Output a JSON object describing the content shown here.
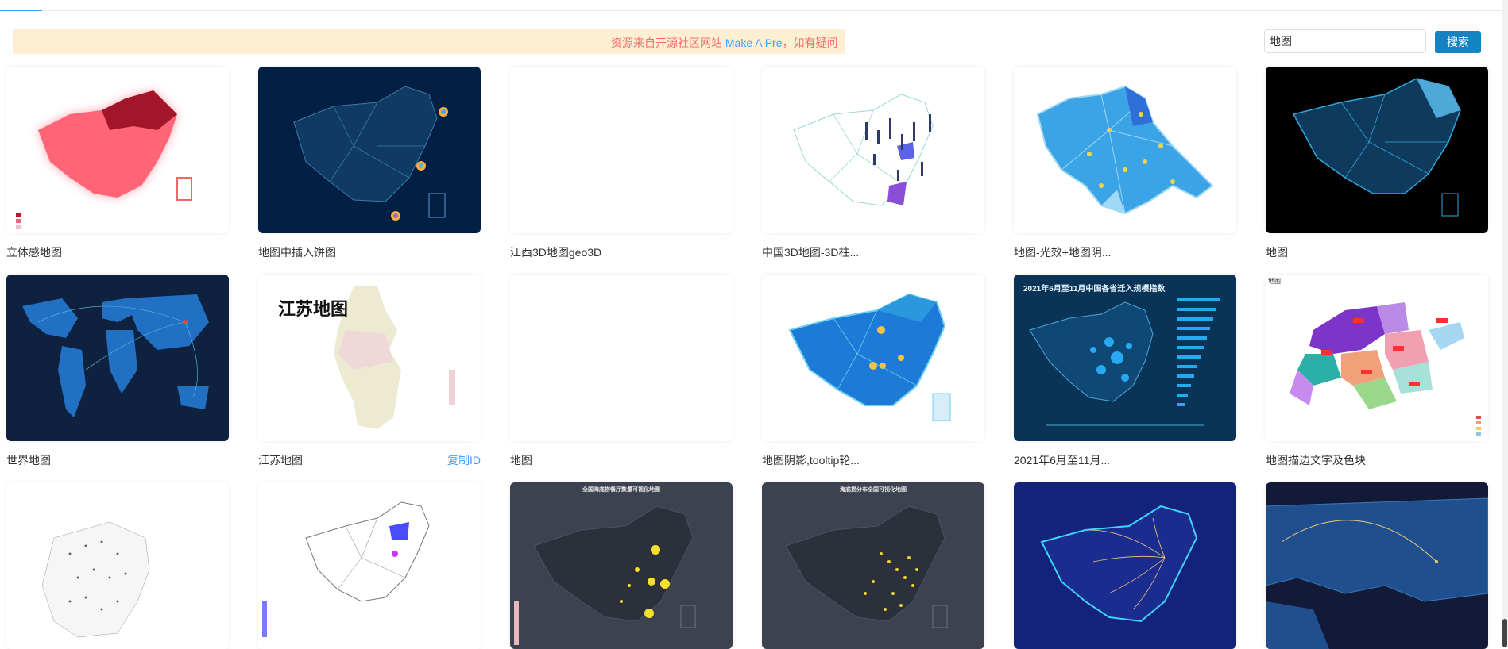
{
  "notice": {
    "prefix": "资源来自开源社区网站 ",
    "link": "Make A Pre",
    "suffix": "，如有疑问"
  },
  "search": {
    "value": "地图",
    "button": "搜索"
  },
  "cards": [
    {
      "title": "立体感地图"
    },
    {
      "title": "地图中插入饼图"
    },
    {
      "title": "江西3D地图geo3D"
    },
    {
      "title": "中国3D地图-3D柱..."
    },
    {
      "title": "地图-光效+地图阴..."
    },
    {
      "title": "地图"
    },
    {
      "title": "世界地图"
    },
    {
      "title": "江苏地图",
      "action": "复制ID",
      "overlay": "江苏地图"
    },
    {
      "title": "地图"
    },
    {
      "title": "地图阴影,tooltip轮..."
    },
    {
      "title": "2021年6月至11月...",
      "overlay": "2021年6月至11月中国各省迁入规模指数"
    },
    {
      "title": "地图描边文字及色块",
      "overlay": "地图"
    },
    {
      "title": ""
    },
    {
      "title": ""
    },
    {
      "title": "",
      "overlay": "全国海底捞餐厅数量可视化地图"
    },
    {
      "title": "",
      "overlay": "海底捞分布全国可视化地图"
    },
    {
      "title": ""
    },
    {
      "title": ""
    }
  ],
  "colors": {
    "accent": "#1483c4",
    "link": "#409eff",
    "notice_bg": "#fdf0d2",
    "notice_text": "#f56c6c"
  }
}
